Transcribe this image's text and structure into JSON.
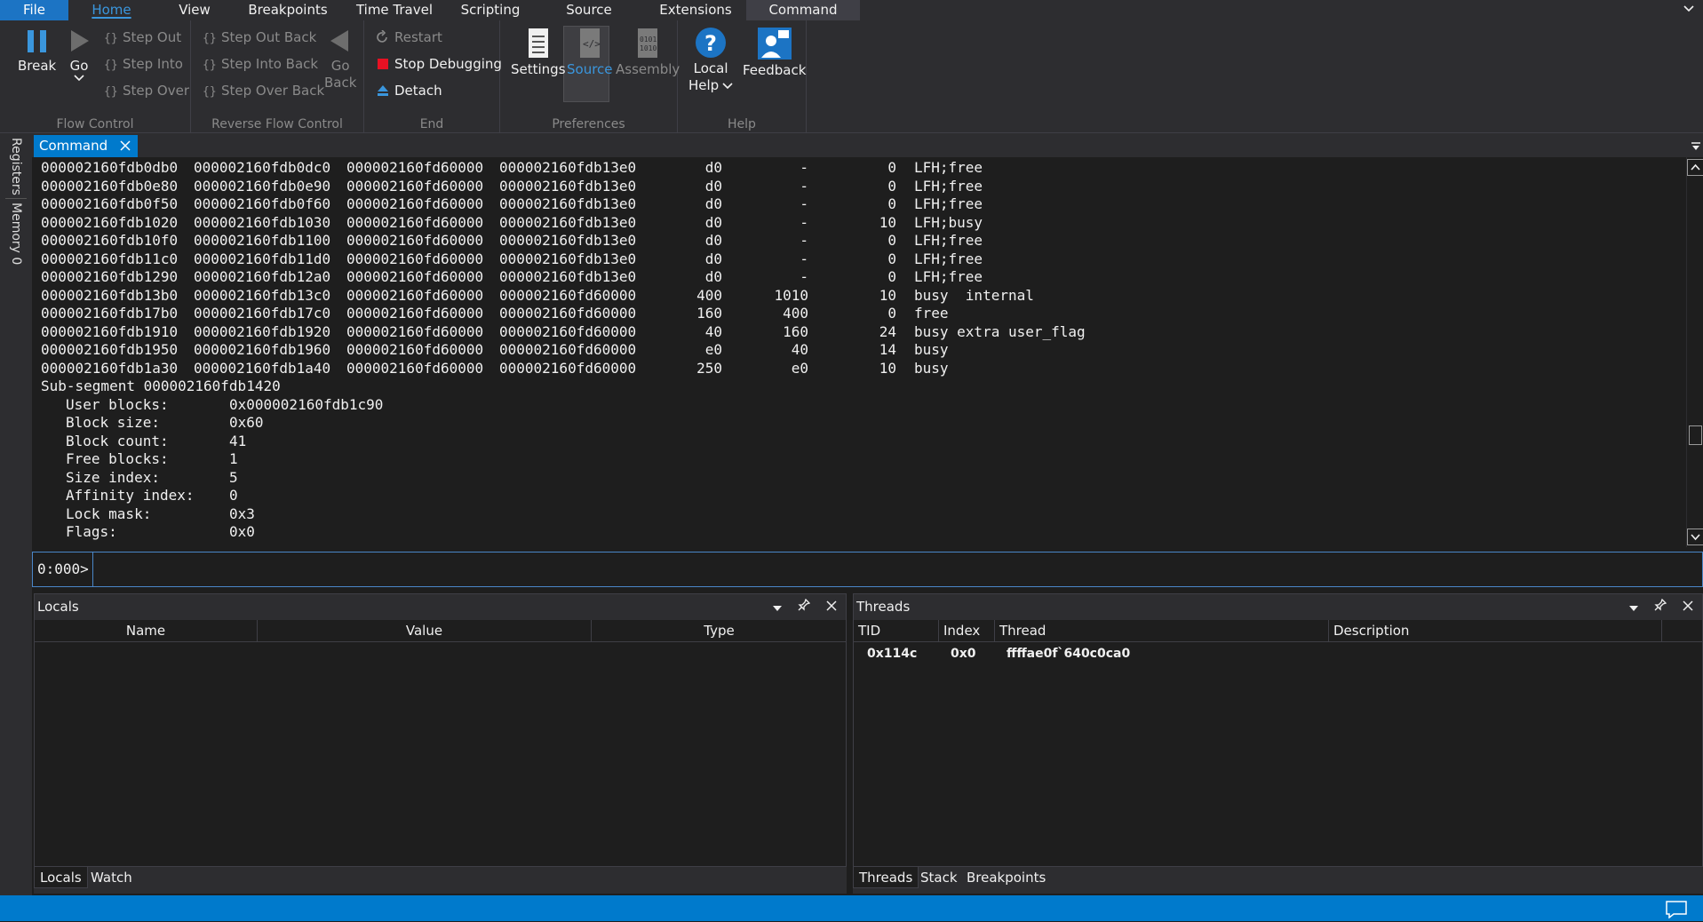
{
  "menu": {
    "items": [
      "File",
      "Home",
      "View",
      "Breakpoints",
      "Time Travel",
      "Scripting",
      "Source",
      "Extensions",
      "Command"
    ]
  },
  "ribbon": {
    "flow_control": {
      "label": "Flow Control",
      "break": "Break",
      "go": "Go",
      "step_out": "Step Out",
      "step_into": "Step Into",
      "step_over": "Step Over"
    },
    "reverse_flow_control": {
      "label": "Reverse Flow Control",
      "step_out_back": "Step Out Back",
      "step_into_back": "Step Into Back",
      "step_over_back": "Step Over Back",
      "go_back_1": "Go",
      "go_back_2": "Back"
    },
    "end": {
      "label": "End",
      "restart": "Restart",
      "stop_debugging": "Stop Debugging",
      "detach": "Detach"
    },
    "preferences": {
      "label": "Preferences",
      "settings": "Settings",
      "source": "Source",
      "assembly": "Assembly"
    },
    "help": {
      "label": "Help",
      "local_help_1": "Local",
      "local_help_2": "Help",
      "feedback": "Feedback"
    }
  },
  "side_tabs": [
    "Registers",
    "Memory 0"
  ],
  "command": {
    "tab_label": "Command",
    "heap_rows": [
      [
        "000002160fdb0db0",
        "000002160fdb0dc0",
        "000002160fd60000",
        "000002160fdb13e0",
        "d0",
        "-",
        "0",
        "LFH;free"
      ],
      [
        "000002160fdb0e80",
        "000002160fdb0e90",
        "000002160fd60000",
        "000002160fdb13e0",
        "d0",
        "-",
        "0",
        "LFH;free"
      ],
      [
        "000002160fdb0f50",
        "000002160fdb0f60",
        "000002160fd60000",
        "000002160fdb13e0",
        "d0",
        "-",
        "0",
        "LFH;free"
      ],
      [
        "000002160fdb1020",
        "000002160fdb1030",
        "000002160fd60000",
        "000002160fdb13e0",
        "d0",
        "-",
        "10",
        "LFH;busy"
      ],
      [
        "000002160fdb10f0",
        "000002160fdb1100",
        "000002160fd60000",
        "000002160fdb13e0",
        "d0",
        "-",
        "0",
        "LFH;free"
      ],
      [
        "000002160fdb11c0",
        "000002160fdb11d0",
        "000002160fd60000",
        "000002160fdb13e0",
        "d0",
        "-",
        "0",
        "LFH;free"
      ],
      [
        "000002160fdb1290",
        "000002160fdb12a0",
        "000002160fd60000",
        "000002160fdb13e0",
        "d0",
        "-",
        "0",
        "LFH;free"
      ],
      [
        "000002160fdb13b0",
        "000002160fdb13c0",
        "000002160fd60000",
        "000002160fd60000",
        "400",
        "1010",
        "10",
        "busy  internal"
      ],
      [
        "000002160fdb17b0",
        "000002160fdb17c0",
        "000002160fd60000",
        "000002160fd60000",
        "160",
        "400",
        "0",
        "free"
      ],
      [
        "000002160fdb1910",
        "000002160fdb1920",
        "000002160fd60000",
        "000002160fd60000",
        "40",
        "160",
        "24",
        "busy extra user_flag"
      ],
      [
        "000002160fdb1950",
        "000002160fdb1960",
        "000002160fd60000",
        "000002160fd60000",
        "e0",
        "40",
        "14",
        "busy"
      ],
      [
        "000002160fdb1a30",
        "000002160fdb1a40",
        "000002160fd60000",
        "000002160fd60000",
        "250",
        "e0",
        "10",
        "busy"
      ]
    ],
    "subsegment_line": "Sub-segment 000002160fdb1420",
    "fields": [
      [
        "User blocks:",
        "0x000002160fdb1c90"
      ],
      [
        "Block size:",
        "0x60"
      ],
      [
        "Block count:",
        "41"
      ],
      [
        "Free blocks:",
        "1"
      ],
      [
        "Size index:",
        "5"
      ],
      [
        "Affinity index:",
        "0"
      ],
      [
        "Lock mask:",
        "0x3"
      ],
      [
        "Flags:",
        "0x0"
      ]
    ],
    "prompt": "0:000>",
    "input_value": ""
  },
  "locals": {
    "title": "Locals",
    "columns": [
      "Name",
      "Value",
      "Type"
    ],
    "tabs": [
      "Locals",
      "Watch"
    ]
  },
  "threads": {
    "title": "Threads",
    "columns": [
      "TID",
      "Index",
      "Thread",
      "Description"
    ],
    "rows": [
      {
        "tid": "0x114c",
        "index": "0x0",
        "thread": "ffffae0f`640c0ca0",
        "description": ""
      }
    ],
    "tabs": [
      "Threads",
      "Stack",
      "Breakpoints"
    ]
  },
  "colors": {
    "accent": "#007acc",
    "stop_red": "#e81123",
    "background": "#1e1e1e",
    "chrome": "#2d2d30"
  }
}
